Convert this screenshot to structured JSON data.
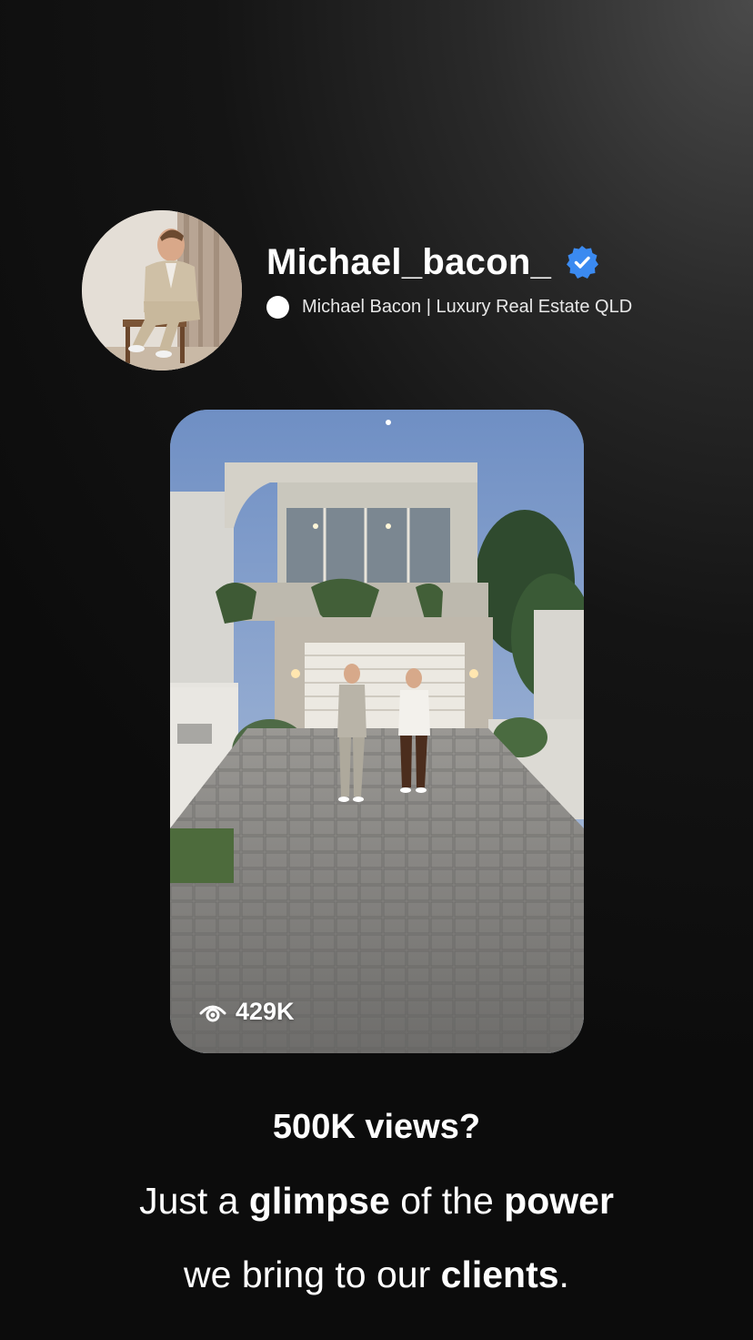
{
  "profile": {
    "username": "Michael_bacon_",
    "display_name": "Michael Bacon | Luxury Real Estate QLD",
    "verified_badge_icon": "verified-check-icon",
    "status_icon": "white-dot-icon",
    "verified_color": "#3b8af0"
  },
  "video": {
    "views": "429K",
    "views_icon": "eye-icon"
  },
  "caption": {
    "headline": "500K views?",
    "line1": {
      "part1": "Just a ",
      "bold1": "glimpse",
      "part2": " of the ",
      "bold2": "power"
    },
    "line2": {
      "part1": "we bring to our ",
      "bold1": "clients",
      "part2": "."
    }
  }
}
